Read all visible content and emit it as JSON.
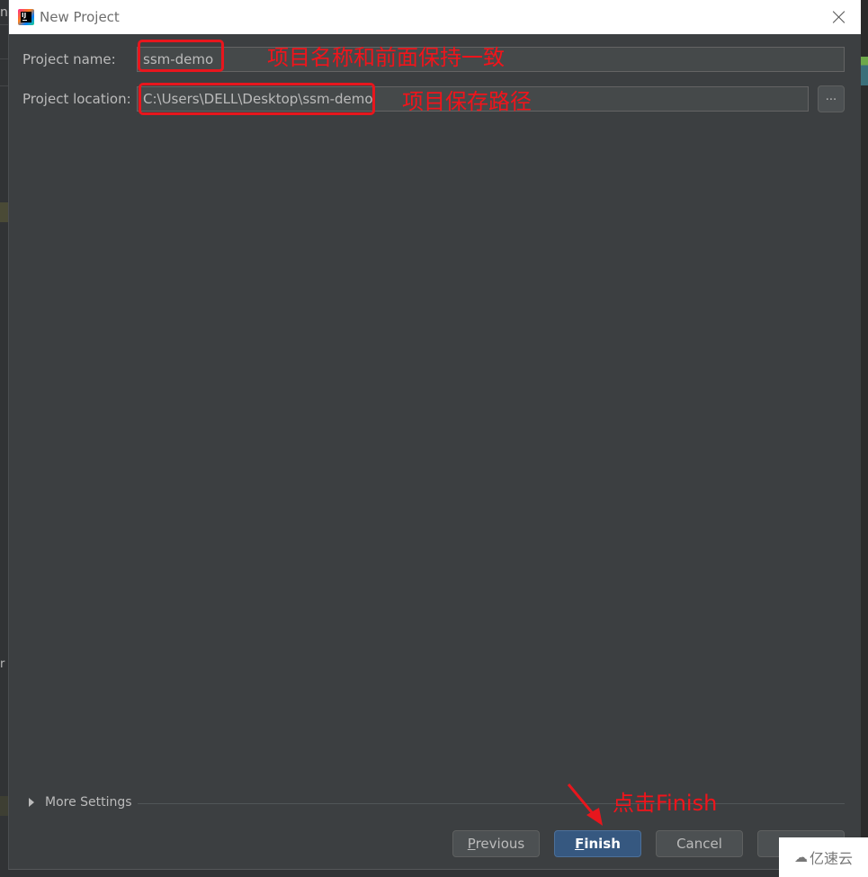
{
  "background": {
    "left_fragment_top": "n",
    "left_fragment_bottom": "r"
  },
  "dialog": {
    "title": "New Project",
    "app_icon": "intellij-idea-icon",
    "close_icon": "close-icon",
    "fields": {
      "project_name": {
        "label": "Project name:",
        "value": "ssm-demo"
      },
      "project_location": {
        "label": "Project location:",
        "value": "C:\\Users\\DELL\\Desktop\\ssm-demo",
        "browse_label": "..."
      }
    },
    "more_settings": {
      "label": "More Settings",
      "icon": "triangle-right-icon"
    },
    "buttons": {
      "previous": {
        "mnemonic": "P",
        "rest": "revious"
      },
      "finish": {
        "mnemonic": "F",
        "rest": "inish"
      },
      "cancel": {
        "label": "Cancel"
      },
      "help": {
        "label": ""
      }
    }
  },
  "annotations": {
    "name_note": "项目名称和前面保持一致",
    "location_note": "项目保存路径",
    "finish_note": "点击Finish",
    "color": "#e8161d"
  },
  "watermark": {
    "icon": "cloud-logo-icon",
    "text": "亿速云"
  },
  "colors": {
    "dialog_bg": "#3c3f41",
    "primary_button": "#365880",
    "text": "#bbbbbb"
  }
}
